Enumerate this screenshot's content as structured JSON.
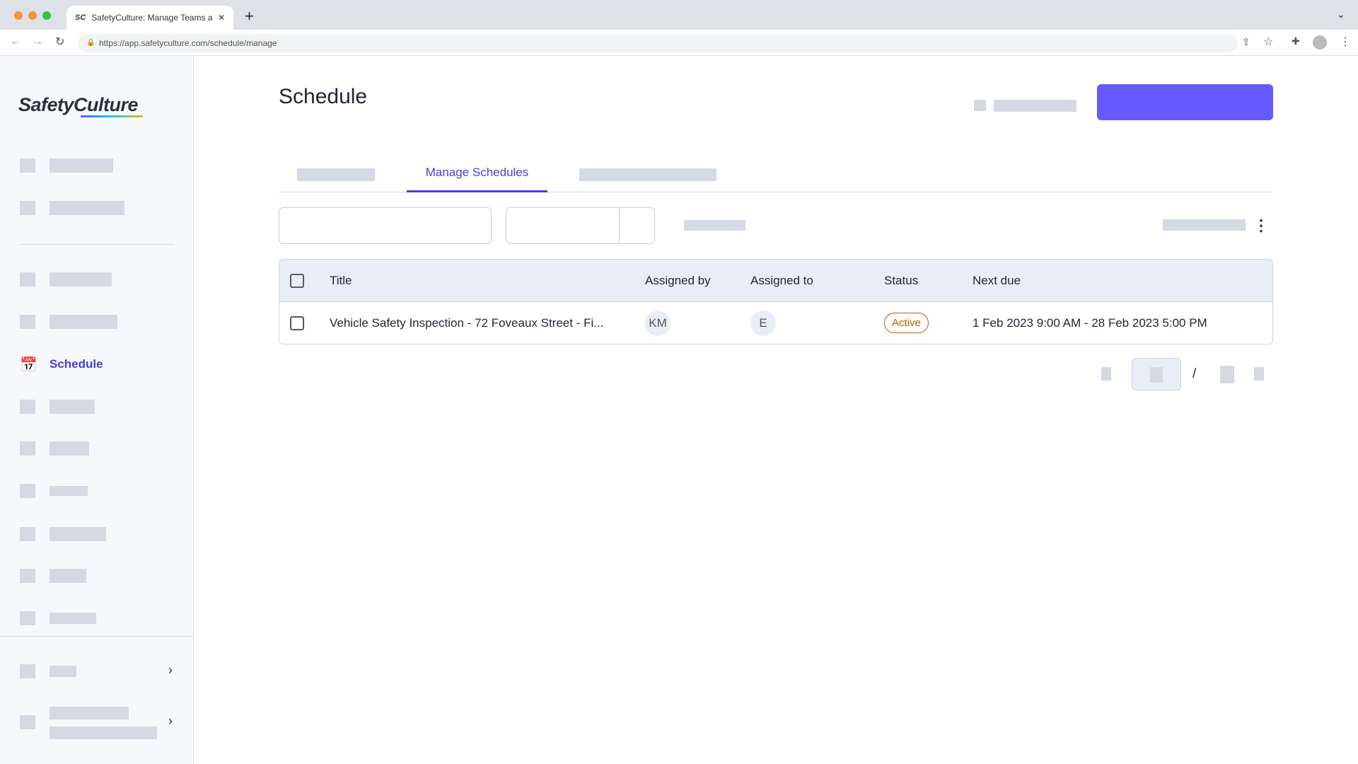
{
  "browser": {
    "tab_title": "SafetyCulture: Manage Teams and ...",
    "url": "https://app.safetyculture.com/schedule/manage",
    "favicon": "SC"
  },
  "sidebar": {
    "logo": "SafetyCulture",
    "active_item": "Schedule"
  },
  "page": {
    "title": "Schedule"
  },
  "tabs": {
    "active": "Manage Schedules"
  },
  "table": {
    "headers": [
      "Title",
      "Assigned by",
      "Assigned to",
      "Status",
      "Next due"
    ],
    "rows": [
      {
        "title": "Vehicle Safety Inspection - 72 Foveaux Street - Fi...",
        "assigned_by": "KM",
        "assigned_to": "E",
        "status": "Active",
        "next_due": "1 Feb 2023 9:00 AM - 28 Feb 2023 5:00 PM"
      }
    ]
  },
  "pagination": {
    "separator": "/"
  },
  "colors": {
    "accent": "#4740d4",
    "primary_button": "#6559ff",
    "status_active": "#c45a00"
  }
}
